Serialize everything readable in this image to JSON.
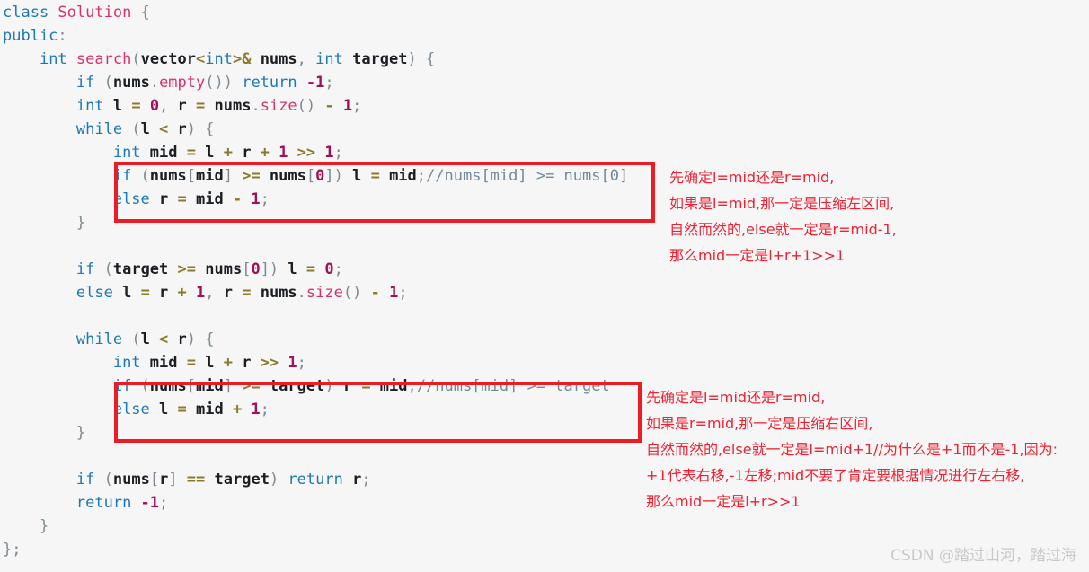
{
  "editor": {
    "background_color": "#f6f6f6",
    "language": "cpp",
    "code_lines": [
      [
        {
          "t": "class ",
          "c": "kw"
        },
        {
          "t": "Solution",
          "c": "fn"
        },
        {
          "t": " {",
          "c": "pun"
        }
      ],
      [
        {
          "t": "public",
          "c": "kw"
        },
        {
          "t": ":",
          "c": "pun"
        }
      ],
      [
        {
          "t": "    ",
          "c": "plain"
        },
        {
          "t": "int ",
          "c": "kw"
        },
        {
          "t": "search",
          "c": "fn"
        },
        {
          "t": "(",
          "c": "pun"
        },
        {
          "t": "vector",
          "c": "id"
        },
        {
          "t": "<",
          "c": "op"
        },
        {
          "t": "int",
          "c": "kw"
        },
        {
          "t": ">&",
          "c": "op"
        },
        {
          "t": " nums",
          "c": "id"
        },
        {
          "t": ", ",
          "c": "pun"
        },
        {
          "t": "int ",
          "c": "kw"
        },
        {
          "t": "target",
          "c": "id"
        },
        {
          "t": ") {",
          "c": "pun"
        }
      ],
      [
        {
          "t": "        ",
          "c": "plain"
        },
        {
          "t": "if ",
          "c": "kw"
        },
        {
          "t": "(",
          "c": "pun"
        },
        {
          "t": "nums",
          "c": "id"
        },
        {
          "t": ".",
          "c": "pun"
        },
        {
          "t": "empty",
          "c": "fn"
        },
        {
          "t": "()) ",
          "c": "pun"
        },
        {
          "t": "return ",
          "c": "kw"
        },
        {
          "t": "-1",
          "c": "num"
        },
        {
          "t": ";",
          "c": "pun"
        }
      ],
      [
        {
          "t": "        ",
          "c": "plain"
        },
        {
          "t": "int ",
          "c": "kw"
        },
        {
          "t": "l ",
          "c": "id"
        },
        {
          "t": "= ",
          "c": "op"
        },
        {
          "t": "0",
          "c": "num"
        },
        {
          "t": ", ",
          "c": "pun"
        },
        {
          "t": "r ",
          "c": "id"
        },
        {
          "t": "= ",
          "c": "op"
        },
        {
          "t": "nums",
          "c": "id"
        },
        {
          "t": ".",
          "c": "pun"
        },
        {
          "t": "size",
          "c": "fn"
        },
        {
          "t": "() ",
          "c": "pun"
        },
        {
          "t": "- ",
          "c": "op"
        },
        {
          "t": "1",
          "c": "num"
        },
        {
          "t": ";",
          "c": "pun"
        }
      ],
      [
        {
          "t": "        ",
          "c": "plain"
        },
        {
          "t": "while ",
          "c": "kw"
        },
        {
          "t": "(",
          "c": "pun"
        },
        {
          "t": "l ",
          "c": "id"
        },
        {
          "t": "< ",
          "c": "op"
        },
        {
          "t": "r",
          "c": "id"
        },
        {
          "t": ") {",
          "c": "pun"
        }
      ],
      [
        {
          "t": "            ",
          "c": "plain"
        },
        {
          "t": "int ",
          "c": "kw"
        },
        {
          "t": "mid ",
          "c": "id"
        },
        {
          "t": "= ",
          "c": "op"
        },
        {
          "t": "l ",
          "c": "id"
        },
        {
          "t": "+ ",
          "c": "op"
        },
        {
          "t": "r ",
          "c": "id"
        },
        {
          "t": "+ ",
          "c": "op"
        },
        {
          "t": "1 ",
          "c": "num"
        },
        {
          "t": ">> ",
          "c": "op"
        },
        {
          "t": "1",
          "c": "num"
        },
        {
          "t": ";",
          "c": "pun"
        }
      ],
      [
        {
          "t": "            ",
          "c": "plain"
        },
        {
          "t": "if ",
          "c": "kw"
        },
        {
          "t": "(",
          "c": "pun"
        },
        {
          "t": "nums",
          "c": "id"
        },
        {
          "t": "[",
          "c": "pun"
        },
        {
          "t": "mid",
          "c": "id"
        },
        {
          "t": "] ",
          "c": "pun"
        },
        {
          "t": ">= ",
          "c": "op"
        },
        {
          "t": "nums",
          "c": "id"
        },
        {
          "t": "[",
          "c": "pun"
        },
        {
          "t": "0",
          "c": "num"
        },
        {
          "t": "]) ",
          "c": "pun"
        },
        {
          "t": "l ",
          "c": "id"
        },
        {
          "t": "= ",
          "c": "op"
        },
        {
          "t": "mid",
          "c": "id"
        },
        {
          "t": ";",
          "c": "pun"
        },
        {
          "t": "//nums[mid] >= nums[0]",
          "c": "cmt"
        }
      ],
      [
        {
          "t": "            ",
          "c": "plain"
        },
        {
          "t": "else ",
          "c": "kw"
        },
        {
          "t": "r ",
          "c": "id"
        },
        {
          "t": "= ",
          "c": "op"
        },
        {
          "t": "mid ",
          "c": "id"
        },
        {
          "t": "- ",
          "c": "op"
        },
        {
          "t": "1",
          "c": "num"
        },
        {
          "t": ";",
          "c": "pun"
        }
      ],
      [
        {
          "t": "        }",
          "c": "pun"
        }
      ],
      [
        {
          "t": " ",
          "c": "plain"
        }
      ],
      [
        {
          "t": "        ",
          "c": "plain"
        },
        {
          "t": "if ",
          "c": "kw"
        },
        {
          "t": "(",
          "c": "pun"
        },
        {
          "t": "target ",
          "c": "id"
        },
        {
          "t": ">= ",
          "c": "op"
        },
        {
          "t": "nums",
          "c": "id"
        },
        {
          "t": "[",
          "c": "pun"
        },
        {
          "t": "0",
          "c": "num"
        },
        {
          "t": "]) ",
          "c": "pun"
        },
        {
          "t": "l ",
          "c": "id"
        },
        {
          "t": "= ",
          "c": "op"
        },
        {
          "t": "0",
          "c": "num"
        },
        {
          "t": ";",
          "c": "pun"
        }
      ],
      [
        {
          "t": "        ",
          "c": "plain"
        },
        {
          "t": "else ",
          "c": "kw"
        },
        {
          "t": "l ",
          "c": "id"
        },
        {
          "t": "= ",
          "c": "op"
        },
        {
          "t": "r ",
          "c": "id"
        },
        {
          "t": "+ ",
          "c": "op"
        },
        {
          "t": "1",
          "c": "num"
        },
        {
          "t": ", ",
          "c": "pun"
        },
        {
          "t": "r ",
          "c": "id"
        },
        {
          "t": "= ",
          "c": "op"
        },
        {
          "t": "nums",
          "c": "id"
        },
        {
          "t": ".",
          "c": "pun"
        },
        {
          "t": "size",
          "c": "fn"
        },
        {
          "t": "() ",
          "c": "pun"
        },
        {
          "t": "- ",
          "c": "op"
        },
        {
          "t": "1",
          "c": "num"
        },
        {
          "t": ";",
          "c": "pun"
        }
      ],
      [
        {
          "t": " ",
          "c": "plain"
        }
      ],
      [
        {
          "t": "        ",
          "c": "plain"
        },
        {
          "t": "while ",
          "c": "kw"
        },
        {
          "t": "(",
          "c": "pun"
        },
        {
          "t": "l ",
          "c": "id"
        },
        {
          "t": "< ",
          "c": "op"
        },
        {
          "t": "r",
          "c": "id"
        },
        {
          "t": ") {",
          "c": "pun"
        }
      ],
      [
        {
          "t": "            ",
          "c": "plain"
        },
        {
          "t": "int ",
          "c": "kw"
        },
        {
          "t": "mid ",
          "c": "id"
        },
        {
          "t": "= ",
          "c": "op"
        },
        {
          "t": "l ",
          "c": "id"
        },
        {
          "t": "+ ",
          "c": "op"
        },
        {
          "t": "r ",
          "c": "id"
        },
        {
          "t": ">> ",
          "c": "op"
        },
        {
          "t": "1",
          "c": "num"
        },
        {
          "t": ";",
          "c": "pun"
        }
      ],
      [
        {
          "t": "            ",
          "c": "plain"
        },
        {
          "t": "if ",
          "c": "kw"
        },
        {
          "t": "(",
          "c": "pun"
        },
        {
          "t": "nums",
          "c": "id"
        },
        {
          "t": "[",
          "c": "pun"
        },
        {
          "t": "mid",
          "c": "id"
        },
        {
          "t": "] ",
          "c": "pun"
        },
        {
          "t": ">= ",
          "c": "op"
        },
        {
          "t": "target",
          "c": "id"
        },
        {
          "t": ") ",
          "c": "pun"
        },
        {
          "t": "r ",
          "c": "id"
        },
        {
          "t": "= ",
          "c": "op"
        },
        {
          "t": "mid",
          "c": "id"
        },
        {
          "t": ";",
          "c": "pun"
        },
        {
          "t": "//nums[mid] >= target",
          "c": "cmt"
        }
      ],
      [
        {
          "t": "            ",
          "c": "plain"
        },
        {
          "t": "else ",
          "c": "kw"
        },
        {
          "t": "l ",
          "c": "id"
        },
        {
          "t": "= ",
          "c": "op"
        },
        {
          "t": "mid ",
          "c": "id"
        },
        {
          "t": "+ ",
          "c": "op"
        },
        {
          "t": "1",
          "c": "num"
        },
        {
          "t": ";",
          "c": "pun"
        }
      ],
      [
        {
          "t": "        }",
          "c": "pun"
        }
      ],
      [
        {
          "t": " ",
          "c": "plain"
        }
      ],
      [
        {
          "t": "        ",
          "c": "plain"
        },
        {
          "t": "if ",
          "c": "kw"
        },
        {
          "t": "(",
          "c": "pun"
        },
        {
          "t": "nums",
          "c": "id"
        },
        {
          "t": "[",
          "c": "pun"
        },
        {
          "t": "r",
          "c": "id"
        },
        {
          "t": "] ",
          "c": "pun"
        },
        {
          "t": "== ",
          "c": "op"
        },
        {
          "t": "target",
          "c": "id"
        },
        {
          "t": ") ",
          "c": "pun"
        },
        {
          "t": "return ",
          "c": "kw"
        },
        {
          "t": "r",
          "c": "id"
        },
        {
          "t": ";",
          "c": "pun"
        }
      ],
      [
        {
          "t": "        ",
          "c": "plain"
        },
        {
          "t": "return ",
          "c": "kw"
        },
        {
          "t": "-1",
          "c": "num"
        },
        {
          "t": ";",
          "c": "pun"
        }
      ],
      [
        {
          "t": "    }",
          "c": "pun"
        }
      ],
      [
        {
          "t": "};",
          "c": "pun"
        }
      ]
    ]
  },
  "highlight_boxes": [
    {
      "name": "first-binary-search-condition",
      "color": "#ec1c24"
    },
    {
      "name": "second-binary-search-condition",
      "color": "#ec1c24"
    }
  ],
  "annotations": {
    "color": "#ee2233",
    "first": [
      "先确定l=mid还是r=mid,",
      "如果是l=mid,那一定是压缩左区间,",
      "自然而然的,else就一定是r=mid-1,",
      "那么mid一定是l+r+1>>1"
    ],
    "second": [
      "先确定是l=mid还是r=mid,",
      "如果是r=mid,那一定是压缩右区间,",
      "自然而然的,else就一定是l=mid+1//为什么是+1而不是-1,因为:",
      "+1代表右移,-1左移;mid不要了肯定要根据情况进行左右移,",
      "那么mid一定是l+r>>1"
    ]
  },
  "watermark": {
    "text": "CSDN @踏过山河，踏过海",
    "color": "#c9c9c9"
  }
}
